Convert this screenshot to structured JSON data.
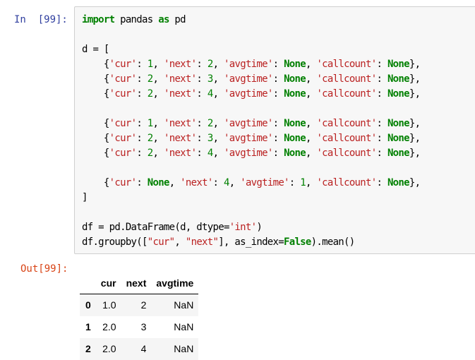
{
  "cell": {
    "in_prompt": "In  [99]:",
    "out_prompt": "Out[99]:",
    "code": {
      "l1": {
        "k1": "import",
        "t1": " pandas ",
        "k2": "as",
        "t2": " pd"
      },
      "l3": "d = [",
      "rows": [
        {
          "cur": "1",
          "next": "2",
          "avg": "None",
          "cc": "None"
        },
        {
          "cur": "2",
          "next": "3",
          "avg": "None",
          "cc": "None"
        },
        {
          "cur": "2",
          "next": "4",
          "avg": "None",
          "cc": "None"
        },
        {
          "cur": "1",
          "next": "2",
          "avg": "None",
          "cc": "None"
        },
        {
          "cur": "2",
          "next": "3",
          "avg": "None",
          "cc": "None"
        },
        {
          "cur": "2",
          "next": "4",
          "avg": "None",
          "cc": "None"
        },
        {
          "cur": "None",
          "next": "4",
          "avg": "1",
          "cc": "None"
        }
      ],
      "keys": {
        "cur": "'cur'",
        "next": "'next'",
        "avg": "'avgtime'",
        "cc": "'callcount'"
      },
      "close": "]",
      "df_line": {
        "a": "df = pd.DataFrame(d, dtype=",
        "b": "'int'",
        "c": ")"
      },
      "gb_line": {
        "a": "df.groupby([",
        "b": "\"cur\"",
        "c": ", ",
        "d": "\"next\"",
        "e": "], as_index=",
        "f": "False",
        "g": ").mean()"
      }
    }
  },
  "output_table": {
    "columns": [
      "",
      "cur",
      "next",
      "avgtime"
    ],
    "rows": [
      {
        "index": "0",
        "cur": "1.0",
        "next": "2",
        "avgtime": "NaN"
      },
      {
        "index": "1",
        "cur": "2.0",
        "next": "3",
        "avgtime": "NaN"
      },
      {
        "index": "2",
        "cur": "2.0",
        "next": "4",
        "avgtime": "NaN"
      }
    ]
  }
}
